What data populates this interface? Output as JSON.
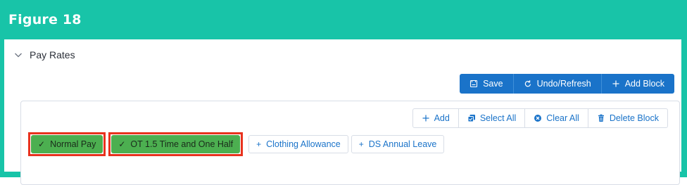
{
  "figure_label": "Figure 18",
  "section": {
    "title": "Pay Rates",
    "expanded": true
  },
  "toolbar": {
    "save_label": "Save",
    "undo_label": "Undo/Refresh",
    "add_block_label": "Add Block"
  },
  "block_toolbar": {
    "add_label": "Add",
    "select_all_label": "Select All",
    "clear_all_label": "Clear All",
    "delete_block_label": "Delete Block"
  },
  "pay_items": [
    {
      "label": "Normal Pay",
      "selected": true,
      "highlighted": true
    },
    {
      "label": "OT 1.5 Time and One Half",
      "selected": true,
      "highlighted": true
    },
    {
      "label": "Clothing Allowance",
      "selected": false,
      "highlighted": false
    },
    {
      "label": "DS Annual Leave",
      "selected": false,
      "highlighted": false
    }
  ],
  "colors": {
    "frame": "#18c4a8",
    "primary": "#1a73c9",
    "selected_pill": "#4caf50",
    "highlight_border": "#e8321e"
  },
  "icons": {
    "chevron": "chevron-down-icon",
    "save": "save-icon",
    "undo": "undo-icon",
    "add_block": "plus-icon",
    "add": "plus-icon",
    "select_all": "select-all-icon",
    "clear_all": "clear-icon",
    "delete_block": "trash-icon",
    "selected_pill": "checkmark-icon",
    "unselected_pill": "plus-icon"
  }
}
